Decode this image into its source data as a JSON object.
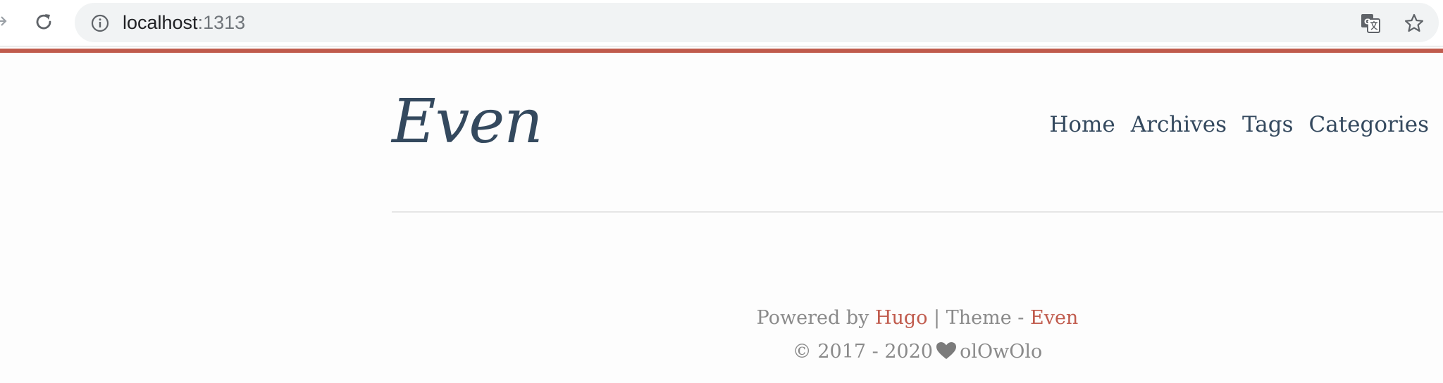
{
  "browser": {
    "address_host": "localhost",
    "address_port": ":1313",
    "icons": [
      "forward-arrow-icon",
      "reload-icon",
      "info-icon",
      "translate-icon",
      "star-icon"
    ]
  },
  "colors": {
    "accent": "#c05b4d",
    "text_primary": "#34495e",
    "text_muted": "#8a8a8a",
    "background": "#fdfdfd"
  },
  "site": {
    "logo": "Even",
    "nav": [
      {
        "label": "Home"
      },
      {
        "label": "Archives"
      },
      {
        "label": "Tags"
      },
      {
        "label": "Categories"
      }
    ]
  },
  "footer": {
    "powered_prefix": "Powered by",
    "hugo_link": "Hugo",
    "theme_sep": "| Theme -",
    "theme_link": "Even",
    "copyright": "© 2017 - 2020",
    "author": "olOwOlo"
  }
}
